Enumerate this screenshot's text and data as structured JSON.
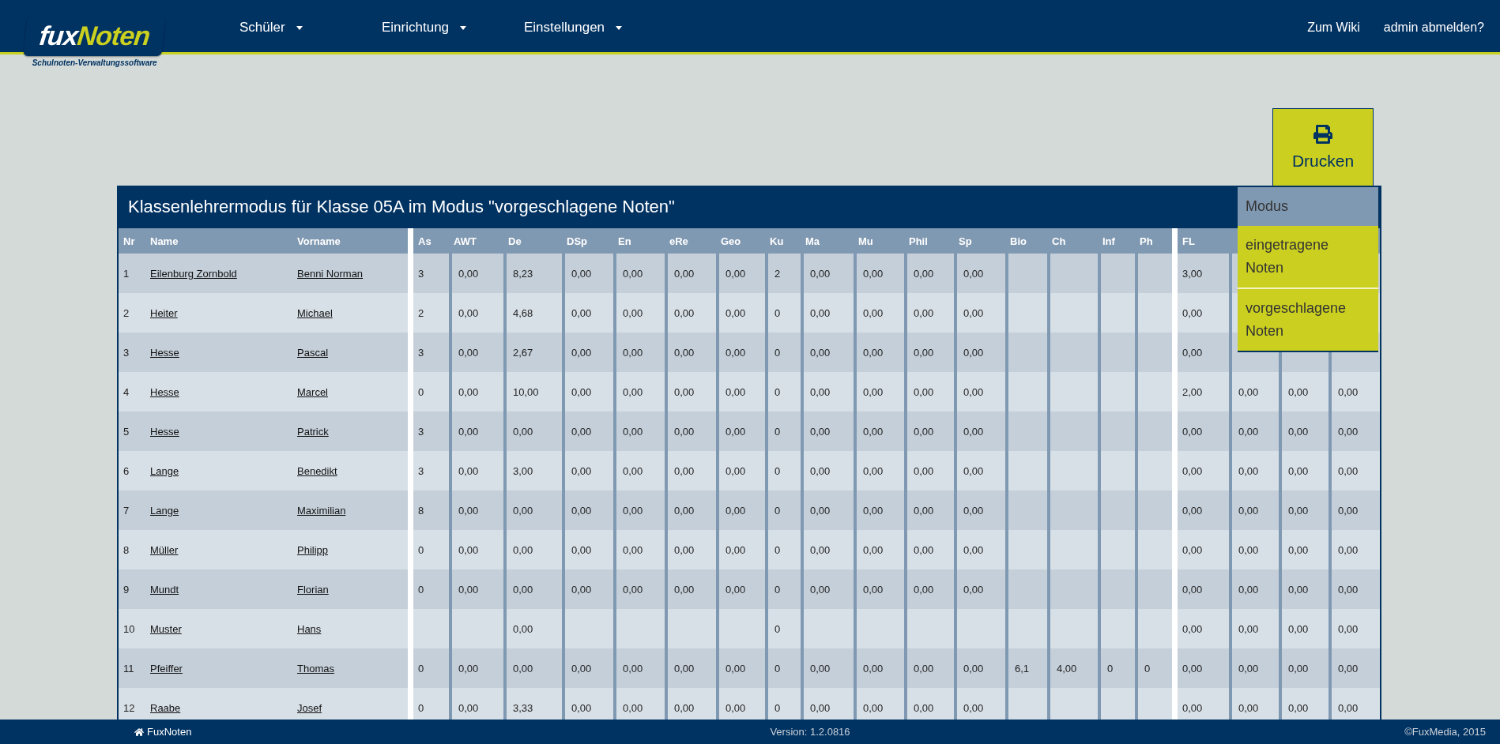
{
  "logo": {
    "brand_prefix": "fux",
    "brand_suffix": "Noten",
    "tagline": "Schulnoten-Verwaltungssoftware"
  },
  "nav": [
    {
      "label": "Schüler"
    },
    {
      "label": "Einrichtung"
    },
    {
      "label": "Einstellungen"
    }
  ],
  "nav_right": [
    "Zum Wiki",
    "admin abmelden?"
  ],
  "print_button": {
    "label": "Drucken"
  },
  "table": {
    "title": "Klassenlehrermodus für Klasse 05A im Modus \"vorgeschlagene Noten\"",
    "columns": [
      "Nr",
      "Name",
      "Vorname"
    ],
    "subject_columns": [
      "As",
      "AWT",
      "De",
      "DSp",
      "En",
      "eRe",
      "Geo",
      "Ku",
      "Ma",
      "Mu",
      "Phil",
      "Sp",
      "Bio",
      "Ch",
      "Inf",
      "Ph"
    ],
    "extra_columns": [
      "FL"
    ],
    "rows": [
      {
        "nr": "1",
        "name": "Eilenburg Zornbold",
        "vorname": "Benni Norman",
        "grades": [
          "3",
          "0,00",
          "8,23",
          "0,00",
          "0,00",
          "0,00",
          "0,00",
          "2",
          "0,00",
          "0,00",
          "0,00",
          "0,00"
        ],
        "extra": [
          "3,00"
        ]
      },
      {
        "nr": "2",
        "name": "Heiter",
        "vorname": "Michael",
        "grades": [
          "2",
          "0,00",
          "4,68",
          "0,00",
          "0,00",
          "0,00",
          "0,00",
          "0",
          "0,00",
          "0,00",
          "0,00",
          "0,00"
        ],
        "extra": [
          "0,00"
        ]
      },
      {
        "nr": "3",
        "name": "Hesse",
        "vorname": "Pascal",
        "grades": [
          "3",
          "0,00",
          "2,67",
          "0,00",
          "0,00",
          "0,00",
          "0,00",
          "0",
          "0,00",
          "0,00",
          "0,00",
          "0,00"
        ],
        "extra": [
          "0,00"
        ]
      },
      {
        "nr": "4",
        "name": "Hesse",
        "vorname": "Marcel",
        "grades": [
          "0",
          "0,00",
          "10,00",
          "0,00",
          "0,00",
          "0,00",
          "0,00",
          "0",
          "0,00",
          "0,00",
          "0,00",
          "0,00"
        ],
        "extra": [
          "2,00",
          "0,00",
          "0,00",
          "0,00"
        ]
      },
      {
        "nr": "5",
        "name": "Hesse",
        "vorname": "Patrick",
        "grades": [
          "3",
          "0,00",
          "0,00",
          "0,00",
          "0,00",
          "0,00",
          "0,00",
          "0",
          "0,00",
          "0,00",
          "0,00",
          "0,00"
        ],
        "extra": [
          "0,00",
          "0,00",
          "0,00",
          "0,00"
        ]
      },
      {
        "nr": "6",
        "name": "Lange",
        "vorname": "Benedikt",
        "grades": [
          "3",
          "0,00",
          "3,00",
          "0,00",
          "0,00",
          "0,00",
          "0,00",
          "0",
          "0,00",
          "0,00",
          "0,00",
          "0,00"
        ],
        "extra": [
          "0,00",
          "0,00",
          "0,00",
          "0,00"
        ]
      },
      {
        "nr": "7",
        "name": "Lange",
        "vorname": "Maximilian",
        "grades": [
          "8",
          "0,00",
          "0,00",
          "0,00",
          "0,00",
          "0,00",
          "0,00",
          "0",
          "0,00",
          "0,00",
          "0,00",
          "0,00"
        ],
        "extra": [
          "0,00",
          "0,00",
          "0,00",
          "0,00"
        ]
      },
      {
        "nr": "8",
        "name": "Müller",
        "vorname": "Philipp",
        "grades": [
          "0",
          "0,00",
          "0,00",
          "0,00",
          "0,00",
          "0,00",
          "0,00",
          "0",
          "0,00",
          "0,00",
          "0,00",
          "0,00"
        ],
        "extra": [
          "0,00",
          "0,00",
          "0,00",
          "0,00"
        ]
      },
      {
        "nr": "9",
        "name": "Mundt",
        "vorname": "Florian",
        "grades": [
          "0",
          "0,00",
          "0,00",
          "0,00",
          "0,00",
          "0,00",
          "0,00",
          "0",
          "0,00",
          "0,00",
          "0,00",
          "0,00"
        ],
        "extra": [
          "0,00",
          "0,00",
          "0,00",
          "0,00"
        ]
      },
      {
        "nr": "10",
        "name": "Muster",
        "vorname": "Hans",
        "grades": [
          {
            "kind": "blank"
          },
          {
            "kind": "blank"
          },
          {
            "kind": "grade",
            "value": "0,00"
          },
          {
            "kind": "blank"
          },
          {
            "kind": "blank"
          },
          {
            "kind": "blank"
          },
          {
            "kind": "blank"
          },
          {
            "kind": "grade",
            "value": "0"
          }
        ],
        "extra": [
          "0,00",
          "0,00",
          "0,00",
          "0,00"
        ]
      },
      {
        "nr": "11",
        "name": "Pfeiffer",
        "vorname": "Thomas",
        "grades": [
          "0",
          "0,00",
          "0,00",
          "0,00",
          "0,00",
          "0,00",
          "0,00",
          "0",
          "0,00",
          "0,00",
          "0,00",
          "0,00",
          "6,1",
          "4,00",
          "0",
          "0"
        ],
        "extra": [
          "0,00",
          "0,00",
          "0,00",
          "0,00"
        ]
      },
      {
        "nr": "12",
        "name": "Raabe",
        "vorname": "Josef",
        "grades": [
          "0",
          "0,00",
          "3,33",
          "0,00",
          "0,00",
          "0,00",
          "0,00",
          "0",
          "0,00",
          "0,00",
          "0,00",
          "0,00"
        ],
        "extra": [
          "0,00",
          "0,00",
          "0,00",
          "0,00"
        ]
      }
    ]
  },
  "mode_menu": {
    "title": "Modus",
    "items": [
      "eingetragene Noten",
      "vorgeschlagene Noten"
    ]
  },
  "footer": {
    "home": "FuxNoten",
    "version": "Version: 1.2.0816",
    "copyright": "©FuxMedia, 2015"
  }
}
